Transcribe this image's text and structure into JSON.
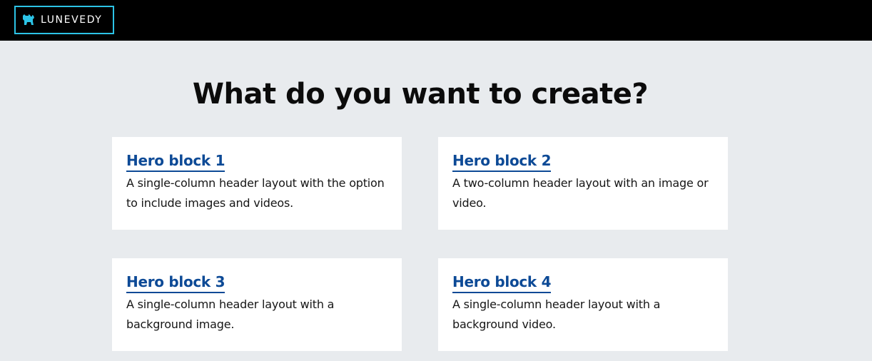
{
  "header": {
    "brand_name": "LUNEVEDY",
    "brand_icon": "dog-icon",
    "accent_color": "#2cc3e6",
    "background_color": "#000000"
  },
  "main": {
    "title": "What do you want to create?",
    "cards": [
      {
        "title": "Hero block 1",
        "description": "A single-column header layout with the option to include images and videos."
      },
      {
        "title": "Hero block 2",
        "description": "A two-column header layout with an image or video."
      },
      {
        "title": "Hero block 3",
        "description": "A single-column header layout with a background image."
      },
      {
        "title": "Hero block 4",
        "description": "A single-column header layout with a background video."
      }
    ],
    "link_color": "#0d4a96",
    "background_color": "#e8ebee"
  }
}
